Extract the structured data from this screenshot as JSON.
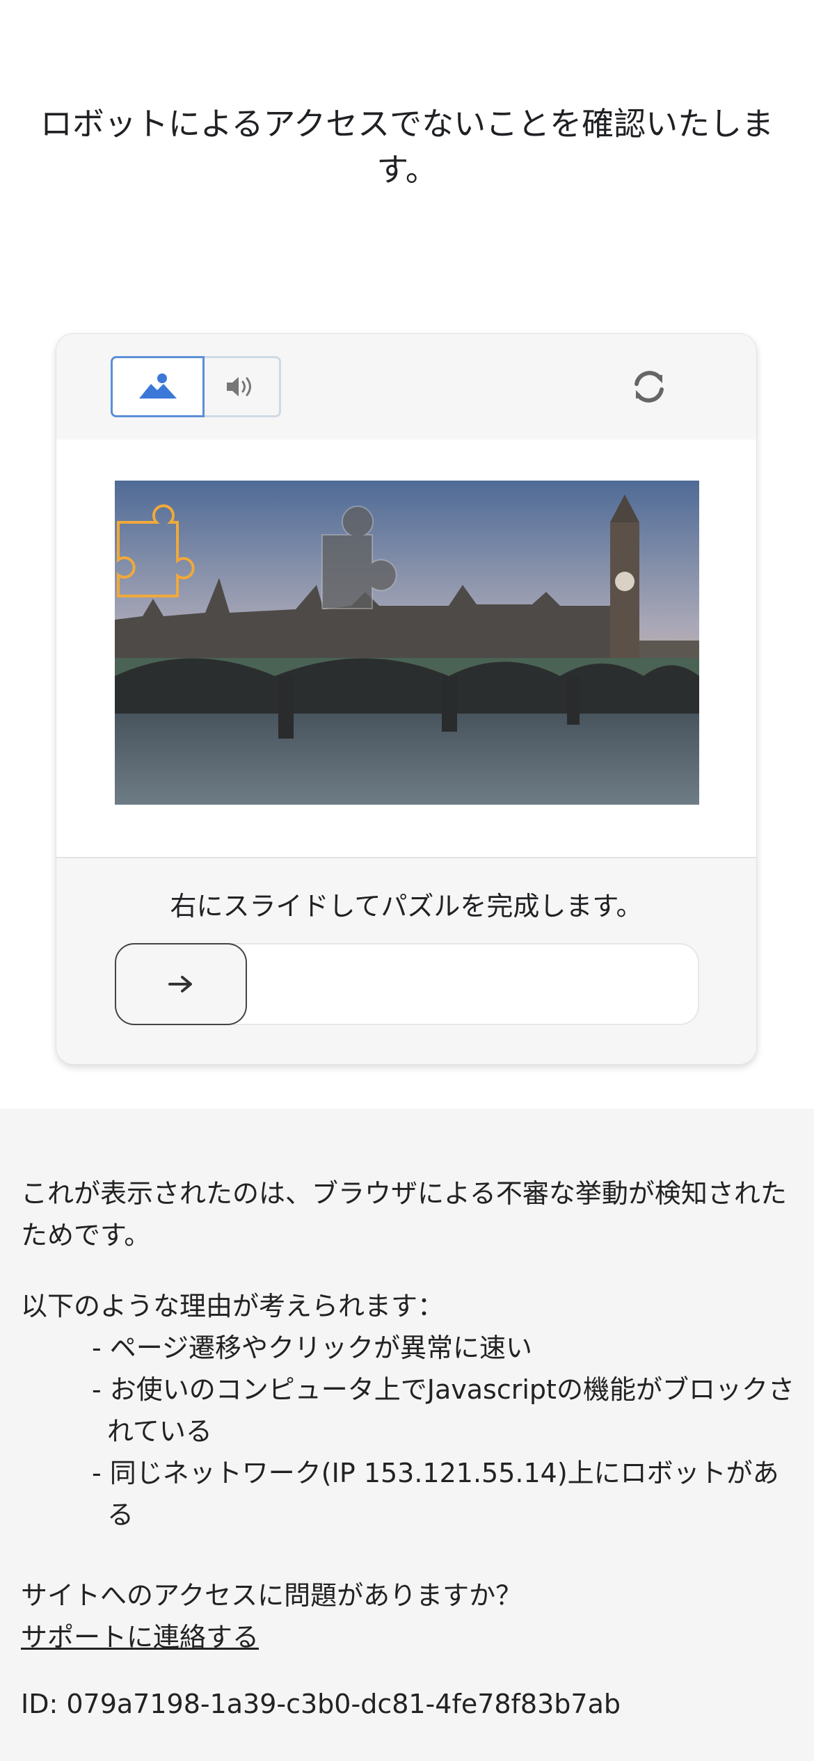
{
  "header": {
    "title": "ロボットによるアクセスでないことを確認いたします。"
  },
  "captcha": {
    "modes": {
      "image_icon": "image-mode-icon",
      "audio_icon": "audio-mode-icon",
      "selected": "image"
    },
    "refresh_icon": "refresh-icon",
    "instruction": "右にスライドしてパズルを完成します。",
    "slider_icon": "arrow-right-icon",
    "accent_color": "#5b8fd8",
    "piece_outline_color": "#f0a93a"
  },
  "info": {
    "reason_intro": "これが表示されたのは、ブラウザによる不審な挙動が検知されたためです。",
    "reasons_title": "以下のような理由が考えられます：",
    "reasons": [
      "- ページ遷移やクリックが異常に速い",
      "- お使いのコンピュータ上でJavascriptの機能がブロックされている",
      "- 同じネットワーク(IP 153.121.55.14)上にロボットがある"
    ],
    "question": "サイトへのアクセスに問題がありますか？",
    "support_link": "サポートに連絡する",
    "id_text": "ID: 079a7198-1a39-c3b0-dc81-4fe78f83b7ab"
  }
}
